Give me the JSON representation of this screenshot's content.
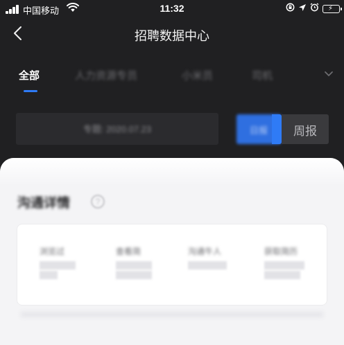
{
  "status_bar": {
    "carrier": "中国移动",
    "time": "11:32"
  },
  "nav": {
    "title": "招聘数据中心",
    "back_icon": "chevron-left-icon"
  },
  "tabs": {
    "items": [
      {
        "label": "全部",
        "active": true
      },
      {
        "label": "人力资源专员",
        "active": false
      },
      {
        "label": "小米员",
        "active": false
      },
      {
        "label": "司机",
        "active": false
      }
    ],
    "more_icon": "chevron-down-icon"
  },
  "filter": {
    "date_label": "专题: 2020.07.23",
    "day_label": "日报",
    "week_label": "周报",
    "accent_color": "#2f7bf6"
  },
  "detail": {
    "title": "沟通详情",
    "help_icon": "question-circle-icon",
    "stats": [
      {
        "label": "浏览过"
      },
      {
        "label": "查看简"
      },
      {
        "label": "沟通牛人"
      },
      {
        "label": "获取简历"
      }
    ]
  }
}
